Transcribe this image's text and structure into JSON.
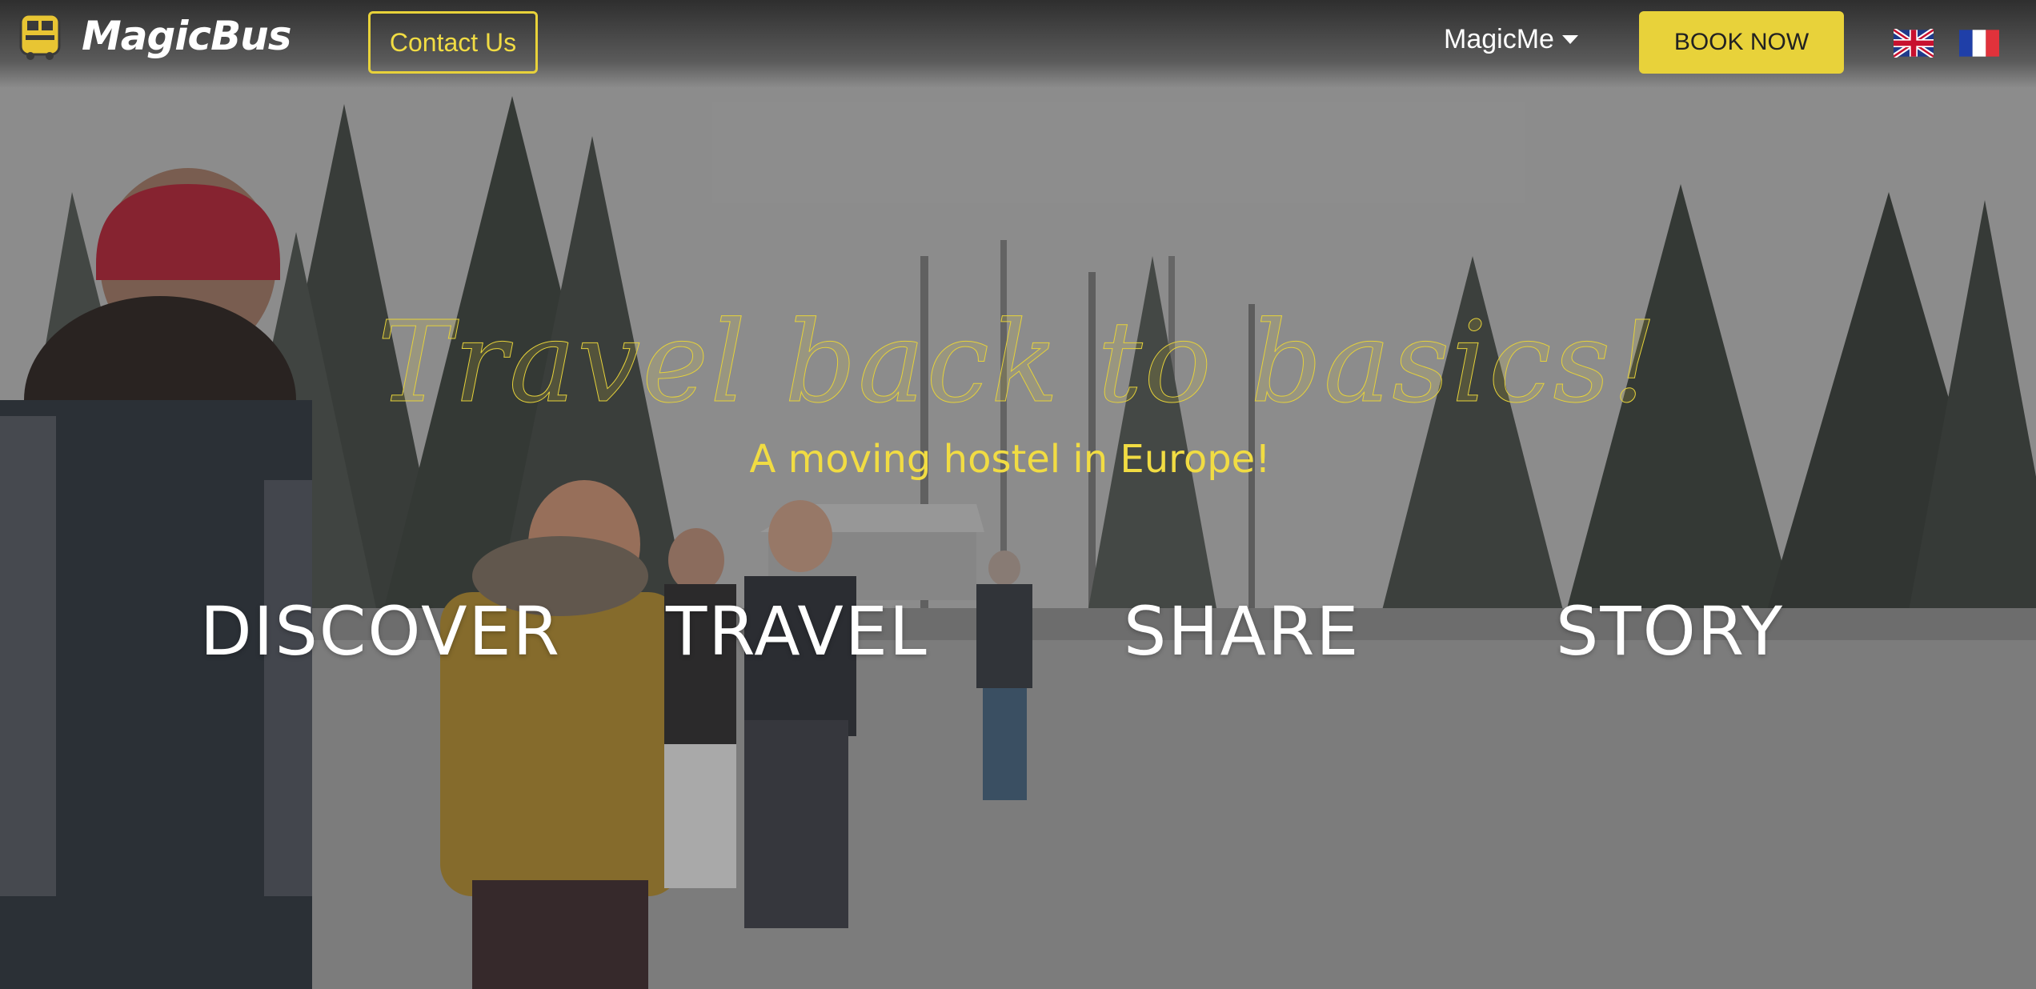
{
  "header": {
    "logo_text": "MagicBus",
    "contact_label": "Contact Us",
    "account_menu_label": "MagicMe",
    "book_label": "BOOK NOW",
    "languages": [
      "en-flag-icon",
      "fr-flag-icon"
    ]
  },
  "hero": {
    "headline": "Travel back to basics!",
    "subheadline": "A moving hostel in Europe!",
    "nav": [
      {
        "label": "DISCOVER"
      },
      {
        "label": "TRAVEL"
      },
      {
        "label": "SHARE"
      },
      {
        "label": "STORY"
      }
    ]
  },
  "colors": {
    "accent": "#e8d23a",
    "header_text": "#ffffff"
  }
}
